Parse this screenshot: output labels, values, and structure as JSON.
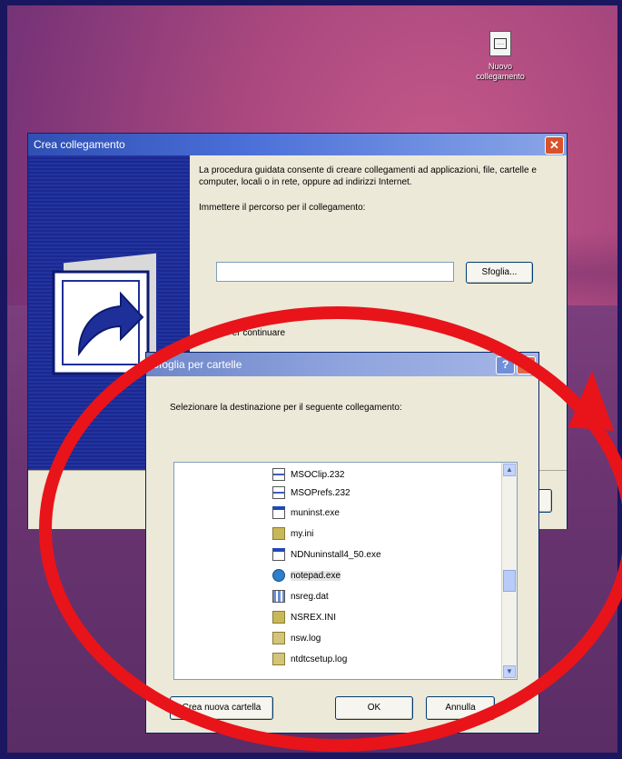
{
  "desktop": {
    "icon_label_line1": "Nuovo",
    "icon_label_line2": "collegamento"
  },
  "wizard": {
    "title": "Crea collegamento",
    "close_glyph": "✕",
    "description": "La procedura guidata consente di creare collegamenti ad applicazioni, file, cartelle e computer, locali o in rete, oppure ad indirizzi Internet.",
    "path_prompt": "Immettere il percorso per il collegamento:",
    "path_value": "",
    "browse_label": "Sfoglia...",
    "continue_text": "Per continuare"
  },
  "browse_dialog": {
    "title": "Sfoglia per cartelle",
    "help_glyph": "?",
    "close_glyph": "✕",
    "instruction": "Selezionare la destinazione per il seguente collegamento:",
    "items": [
      {
        "name": "MSOClip.232",
        "icon": "clip"
      },
      {
        "name": "MSOPrefs.232",
        "icon": "clip"
      },
      {
        "name": "muninst.exe",
        "icon": "exe"
      },
      {
        "name": "my.ini",
        "icon": "ini"
      },
      {
        "name": "NDNuninstall4_50.exe",
        "icon": "exe"
      },
      {
        "name": "notepad.exe",
        "icon": "app",
        "selected": true
      },
      {
        "name": "nsreg.dat",
        "icon": "dat"
      },
      {
        "name": "NSREX.INI",
        "icon": "ini"
      },
      {
        "name": "nsw.log",
        "icon": "log"
      },
      {
        "name": "ntdtcsetup.log",
        "icon": "log"
      }
    ],
    "new_folder_label": "Crea nuova cartella",
    "ok_label": "OK",
    "cancel_label": "Annulla"
  },
  "annotation_color": "#e8141a"
}
